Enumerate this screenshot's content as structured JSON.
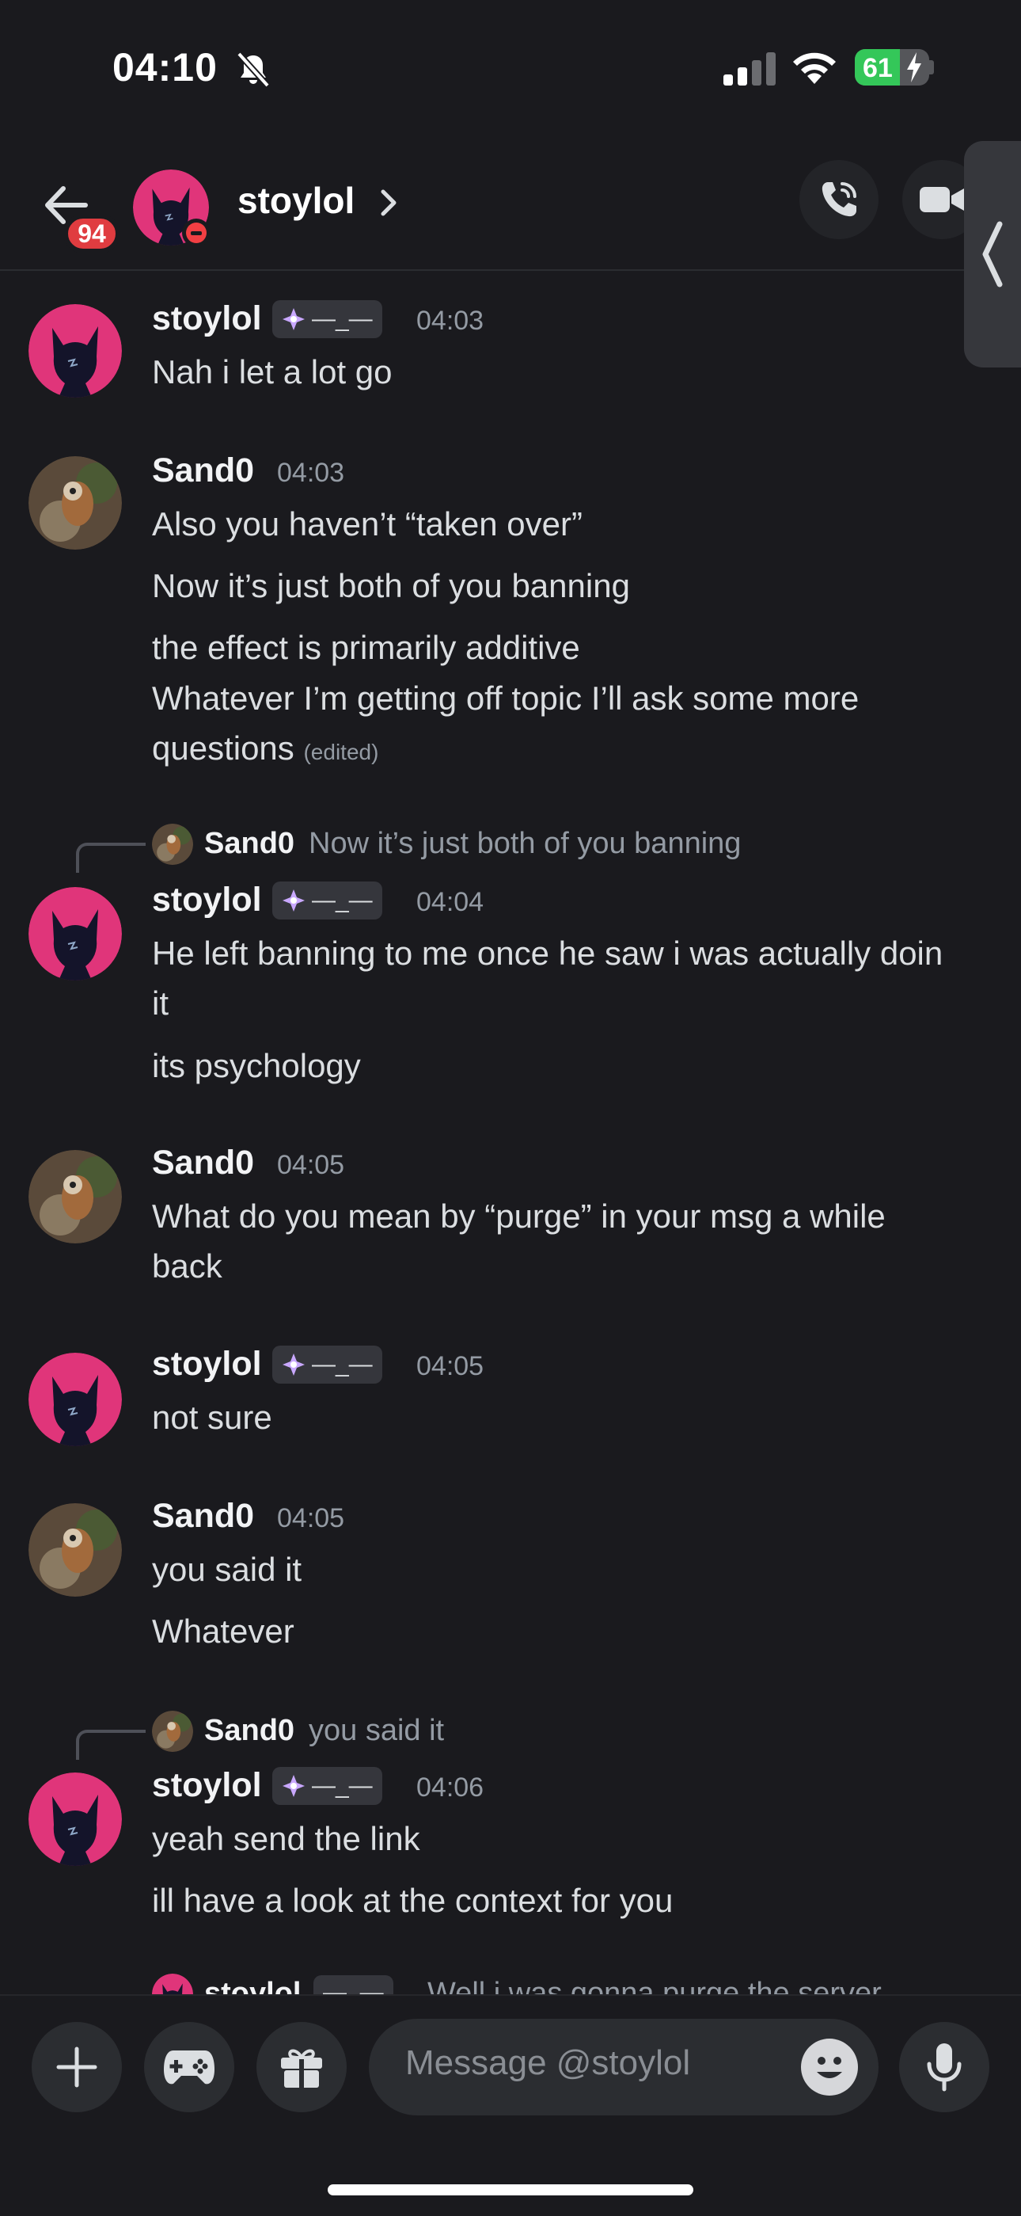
{
  "status_bar": {
    "time": "04:10",
    "battery": "61",
    "battery_level": 0.61
  },
  "header": {
    "unread_badge": "94",
    "username": "stoylol"
  },
  "tag_text": "—_—",
  "messages": [
    {
      "author": "stoylol",
      "time": "04:03",
      "lines": [
        "Nah i let a lot go"
      ]
    },
    {
      "author": "Sand0",
      "time": "04:03",
      "lines": [
        "Also you haven’t “taken over”",
        "Now it’s just both of you banning",
        "the effect is primarily additive"
      ],
      "wrapped": "Whatever I’m getting off topic I’ll ask some more questions",
      "edited": "(edited)"
    },
    {
      "reply": {
        "author": "Sand0",
        "text": "Now it’s just both of you banning"
      },
      "author": "stoylol",
      "time": "04:04",
      "lines": [
        "He left banning to me once he saw i was actually doin it",
        "its psychology"
      ]
    },
    {
      "author": "Sand0",
      "time": "04:05",
      "lines": [
        "What do you mean by “purge” in your msg a while back"
      ]
    },
    {
      "author": "stoylol",
      "time": "04:05",
      "lines": [
        "not sure"
      ]
    },
    {
      "author": "Sand0",
      "time": "04:05",
      "lines": [
        "you said it",
        "Whatever"
      ]
    },
    {
      "reply": {
        "author": "Sand0",
        "text": "you said it"
      },
      "author": "stoylol",
      "time": "04:06",
      "lines": [
        "yeah send the link",
        "ill have a look at the context for you"
      ]
    },
    {
      "partial_author": "stoylol",
      "partial_text": "Well i was gonna purge the server"
    }
  ],
  "composer": {
    "placeholder": "Message @stoylol"
  },
  "colors": {
    "accent_pink": "#e0357a",
    "dnd_red": "#f23f43",
    "badge_red": "#e03c40",
    "battery_green": "#34c759"
  },
  "icons": [
    "bell-slash-icon",
    "signal-icon",
    "wifi-icon",
    "battery-icon",
    "back-arrow-icon",
    "chevron-right-icon",
    "phone-call-icon",
    "video-icon",
    "collapse-panel-icon",
    "plus-icon",
    "gamepad-icon",
    "gift-icon",
    "emoji-icon",
    "microphone-icon"
  ]
}
